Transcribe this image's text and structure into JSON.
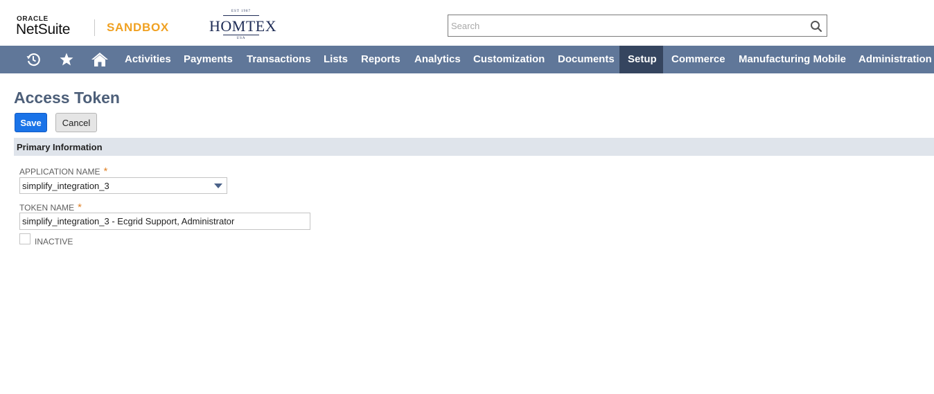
{
  "header": {
    "oracle_label": "ORACLE",
    "netsuite_label": "NetSuite",
    "environment_label": "SANDBOX",
    "brand": {
      "est": "EST 1987",
      "name": "HOMTEX",
      "country": "USA"
    },
    "search": {
      "value": "",
      "placeholder": "Search"
    }
  },
  "nav": {
    "icons": [
      "recent-records-icon",
      "star-icon",
      "home-icon"
    ],
    "items": [
      {
        "label": "Activities"
      },
      {
        "label": "Payments"
      },
      {
        "label": "Transactions"
      },
      {
        "label": "Lists"
      },
      {
        "label": "Reports"
      },
      {
        "label": "Analytics"
      },
      {
        "label": "Customization"
      },
      {
        "label": "Documents"
      },
      {
        "label": "Setup",
        "active": true
      },
      {
        "label": "Commerce"
      },
      {
        "label": "Manufacturing Mobile"
      },
      {
        "label": "Administration a"
      }
    ]
  },
  "page": {
    "title": "Access Token",
    "save_label": "Save",
    "cancel_label": "Cancel",
    "section_title": "Primary Information",
    "fields": {
      "application_name": {
        "label": "APPLICATION NAME",
        "required_mark": "*",
        "value": "simplify_integration_3"
      },
      "token_name": {
        "label": "TOKEN NAME",
        "required_mark": "*",
        "value": "simplify_integration_3 - Ecgrid Support, Administrator"
      },
      "inactive": {
        "label": "INACTIVE",
        "checked": false
      }
    }
  },
  "colors": {
    "nav_bg": "#607799",
    "nav_active_bg": "#35455f",
    "title": "#4d5f79",
    "sandbox": "#f0a122",
    "save_button": "#1a73e8",
    "section_bg": "#dfe4eb",
    "required": "#e0842b"
  }
}
